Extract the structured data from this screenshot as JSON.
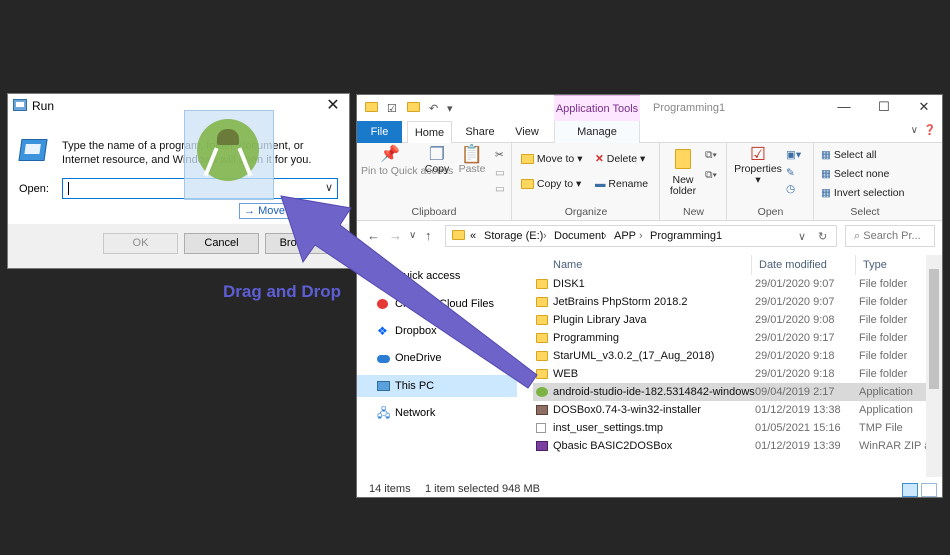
{
  "annotation": {
    "drag_label": "Drag and Drop",
    "arrow_color": "#6e63c8"
  },
  "run_dialog": {
    "title": "Run",
    "description": "Type the name of a program, folder, document, or Internet resource, and Windows will open it for you.",
    "open_label": "Open:",
    "open_value": "",
    "move_tip": "Move",
    "buttons": {
      "ok": "OK",
      "cancel": "Cancel",
      "browse": "Browse..."
    }
  },
  "explorer": {
    "window_title": "Programming1",
    "context_tab": "Application Tools",
    "tabs": [
      "File",
      "Home",
      "Share",
      "View",
      "Manage"
    ],
    "ribbon": {
      "clipboard": {
        "label": "Clipboard",
        "pin": "Pin to Quick access",
        "copy": "Copy",
        "paste": "Paste"
      },
      "organize": {
        "label": "Organize",
        "move_to": "Move to",
        "copy_to": "Copy to",
        "delete": "Delete",
        "rename": "Rename"
      },
      "new": {
        "label": "New",
        "new_folder": "New folder"
      },
      "open": {
        "label": "Open",
        "properties": "Properties"
      },
      "select": {
        "label": "Select",
        "select_all": "Select all",
        "select_none": "Select none",
        "invert": "Invert selection"
      }
    },
    "address": {
      "crumbs": [
        "«",
        "Storage (E:)",
        "Document",
        "APP",
        "Programming1"
      ],
      "search_placeholder": "Search Pr..."
    },
    "nav_pane": [
      {
        "label": "Quick access",
        "icon": "star-icon"
      },
      {
        "label": "Creative Cloud Files",
        "icon": "creative-cloud-icon"
      },
      {
        "label": "Dropbox",
        "icon": "dropbox-icon"
      },
      {
        "label": "OneDrive",
        "icon": "onedrive-icon"
      },
      {
        "label": "This PC",
        "icon": "computer-icon",
        "selected": true
      },
      {
        "label": "Network",
        "icon": "network-icon"
      }
    ],
    "columns": {
      "name": "Name",
      "date": "Date modified",
      "type": "Type"
    },
    "files": [
      {
        "name": "DISK1",
        "date": "29/01/2020 9:07",
        "type": "File folder",
        "icon": "folder-icon"
      },
      {
        "name": "JetBrains PhpStorm 2018.2",
        "date": "29/01/2020 9:07",
        "type": "File folder",
        "icon": "folder-icon"
      },
      {
        "name": "Plugin Library Java",
        "date": "29/01/2020 9:08",
        "type": "File folder",
        "icon": "folder-icon"
      },
      {
        "name": "Programming",
        "date": "29/01/2020 9:17",
        "type": "File folder",
        "icon": "folder-icon"
      },
      {
        "name": "StarUML_v3.0.2_(17_Aug_2018)",
        "date": "29/01/2020 9:18",
        "type": "File folder",
        "icon": "folder-icon"
      },
      {
        "name": "WEB",
        "date": "29/01/2020 9:18",
        "type": "File folder",
        "icon": "folder-icon"
      },
      {
        "name": "android-studio-ide-182.5314842-windows",
        "date": "09/04/2019 2:17",
        "type": "Application",
        "icon": "android-studio-icon",
        "selected": true
      },
      {
        "name": "DOSBox0.74-3-win32-installer",
        "date": "01/12/2019 13:38",
        "type": "Application",
        "icon": "dosbox-icon"
      },
      {
        "name": "inst_user_settings.tmp",
        "date": "01/05/2021 15:16",
        "type": "TMP File",
        "icon": "file-icon"
      },
      {
        "name": "Qbasic BASIC2DOSBox",
        "date": "01/12/2019 13:39",
        "type": "WinRAR ZIP ar",
        "icon": "zip-icon"
      }
    ],
    "status": {
      "count": "14 items",
      "selection": "1 item selected  948 MB"
    }
  }
}
